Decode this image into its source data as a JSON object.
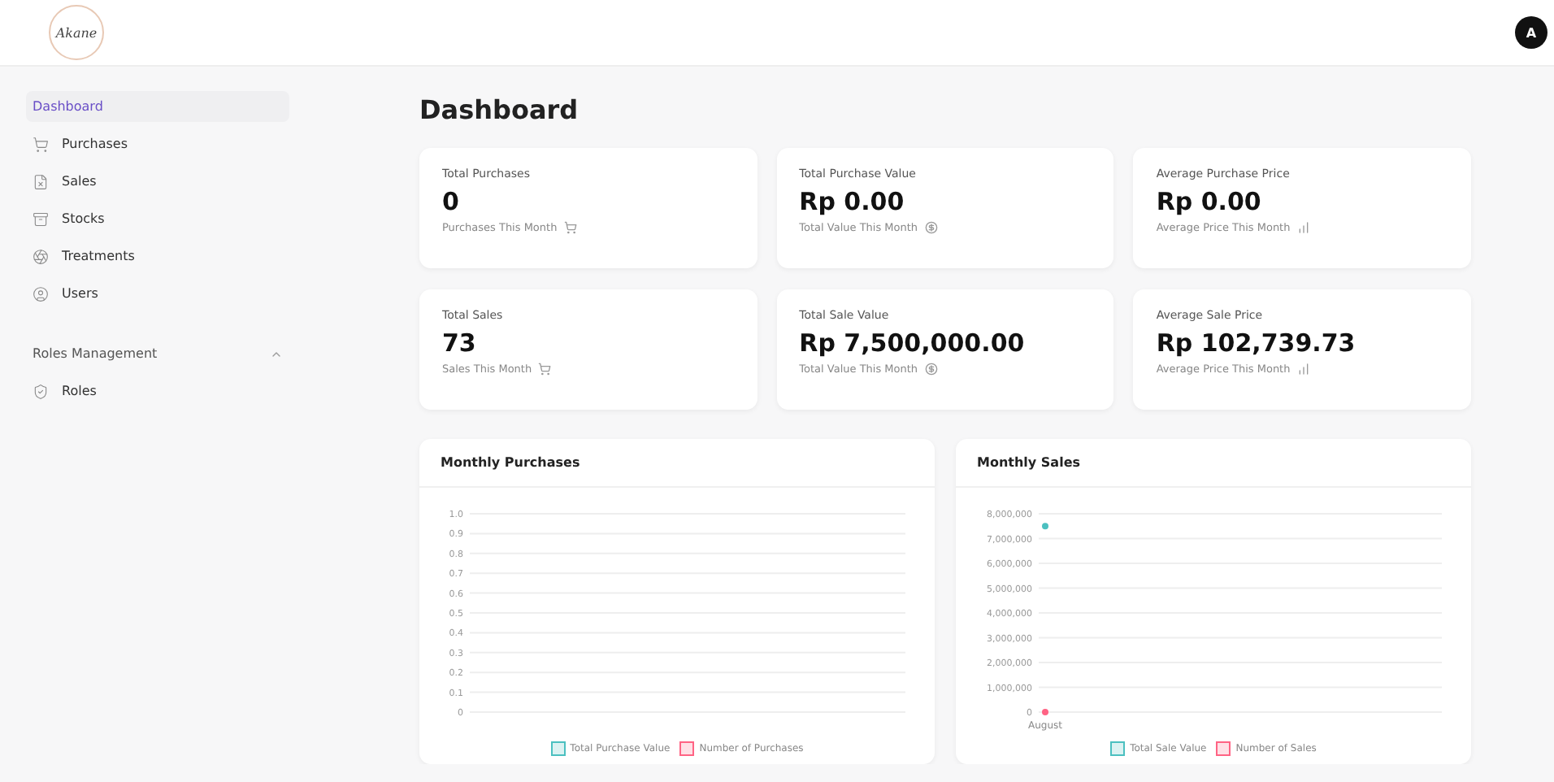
{
  "header": {
    "logo": "Akane",
    "avatar": "A"
  },
  "sidebar": {
    "items": [
      {
        "label": "Dashboard",
        "selected": true
      },
      {
        "label": "Purchases",
        "selected": false
      },
      {
        "label": "Sales",
        "selected": false
      },
      {
        "label": "Stocks",
        "selected": false
      },
      {
        "label": "Treatments",
        "selected": false
      },
      {
        "label": "Users",
        "selected": false
      }
    ],
    "sections": [
      {
        "title": "Roles Management",
        "expanded": true,
        "items": [
          {
            "label": "Roles",
            "selected": false
          }
        ]
      }
    ]
  },
  "page_title": "Dashboard",
  "stat_cards": [
    {
      "label": "Total Purchases",
      "value": "0",
      "note": "Purchases This Month"
    },
    {
      "label": "Total Purchase Value",
      "value": "Rp 0.00",
      "note": "Total Value This Month"
    },
    {
      "label": "Average Purchase Price",
      "value": "Rp 0.00",
      "note": "Average Price This Month"
    },
    {
      "label": "Total Sales",
      "value": "73",
      "note": "Sales This Month"
    },
    {
      "label": "Total Sale Value",
      "value": "Rp 7,500,000.00",
      "note": "Total Value This Month"
    },
    {
      "label": "Average Sale Price",
      "value": "Rp 102,739.73",
      "note": "Average Price This Month"
    }
  ],
  "charts": [
    {
      "title": "Monthly Purchases",
      "chart_data": {
        "type": "line",
        "grid": true,
        "ylim": [
          0,
          1
        ],
        "yticks": [
          {
            "value": 0,
            "label": "0"
          },
          {
            "value": 0.1,
            "label": "0.1"
          },
          {
            "value": 0.2,
            "label": "0.2"
          },
          {
            "value": 0.3,
            "label": "0.3"
          },
          {
            "value": 0.4,
            "label": "0.4"
          },
          {
            "value": 0.5,
            "label": "0.5"
          },
          {
            "value": 0.6,
            "label": "0.6"
          },
          {
            "value": 0.7,
            "label": "0.7"
          },
          {
            "value": 0.8,
            "label": "0.8"
          },
          {
            "value": 0.9,
            "label": "0.9"
          },
          {
            "value": 1,
            "label": "1.0"
          }
        ],
        "series": [
          {
            "name": "Total Purchase Value",
            "color": "#4bc0c0"
          },
          {
            "name": "Number of Purchases",
            "color": "#ff6384"
          }
        ]
      }
    },
    {
      "title": "Monthly Sales",
      "chart_data": {
        "type": "line",
        "grid": true,
        "categories": [
          "August"
        ],
        "ylim": [
          0,
          8000000
        ],
        "yticks": [
          {
            "value": 0,
            "label": "0"
          },
          {
            "value": 1000000,
            "label": "1,000,000"
          },
          {
            "value": 2000000,
            "label": "2,000,000"
          },
          {
            "value": 3000000,
            "label": "3,000,000"
          },
          {
            "value": 4000000,
            "label": "4,000,000"
          },
          {
            "value": 5000000,
            "label": "5,000,000"
          },
          {
            "value": 6000000,
            "label": "6,000,000"
          },
          {
            "value": 7000000,
            "label": "7,000,000"
          },
          {
            "value": 8000000,
            "label": "8,000,000"
          }
        ],
        "series": [
          {
            "name": "Total Sale Value",
            "color": "#4bc0c0",
            "marker": "circle",
            "values": [
              7500000
            ]
          },
          {
            "name": "Number of Sales",
            "color": "#ff6384",
            "marker": "circle",
            "values": [
              73
            ]
          }
        ]
      }
    }
  ]
}
